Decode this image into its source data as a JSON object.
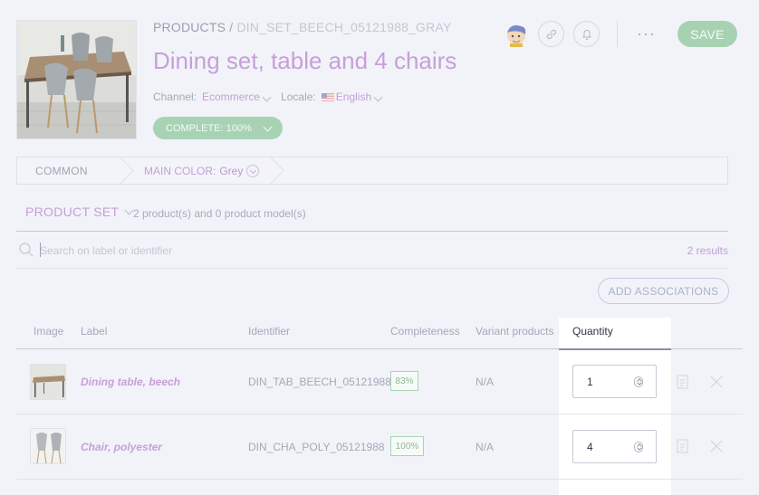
{
  "header": {
    "breadcrumb_root": "PRODUCTS",
    "breadcrumb_separator": " / ",
    "breadcrumb_sku": "DIN_SET_BEECH_05121988_GRAY",
    "title": "Dining set, table and 4 chairs",
    "channel_label": "Channel:",
    "channel_value": "Ecommerce",
    "locale_label": "Locale:",
    "locale_value": "English",
    "completeness": "COMPLETE: 100%",
    "save_label": "SAVE",
    "more_label": "···"
  },
  "variant_nav": {
    "common_label": "COMMON",
    "axis_label": "MAIN COLOR:",
    "axis_value": "Grey"
  },
  "associations": {
    "type_label": "PRODUCT SET",
    "count_text": "2 product(s) and 0 product model(s)",
    "search_placeholder": "Search on label or identifier",
    "results_text": "2 results",
    "add_button": "ADD ASSOCIATIONS"
  },
  "table": {
    "columns": [
      "Image",
      "Label",
      "Identifier",
      "Completeness",
      "Variant products",
      "Quantity"
    ],
    "rows": [
      {
        "label": "Dining table, beech",
        "identifier": "DIN_TAB_BEECH_05121988",
        "completeness": "83%",
        "variant": "N/A",
        "quantity": "1"
      },
      {
        "label": "Chair, polyester",
        "identifier": "DIN_CHA_POLY_05121988",
        "completeness": "100%",
        "variant": "N/A",
        "quantity": "4"
      }
    ]
  },
  "colors": {
    "accent_purple": "#c89fd8",
    "success_green": "#a8d2b4",
    "background": "#f1f3f9"
  }
}
